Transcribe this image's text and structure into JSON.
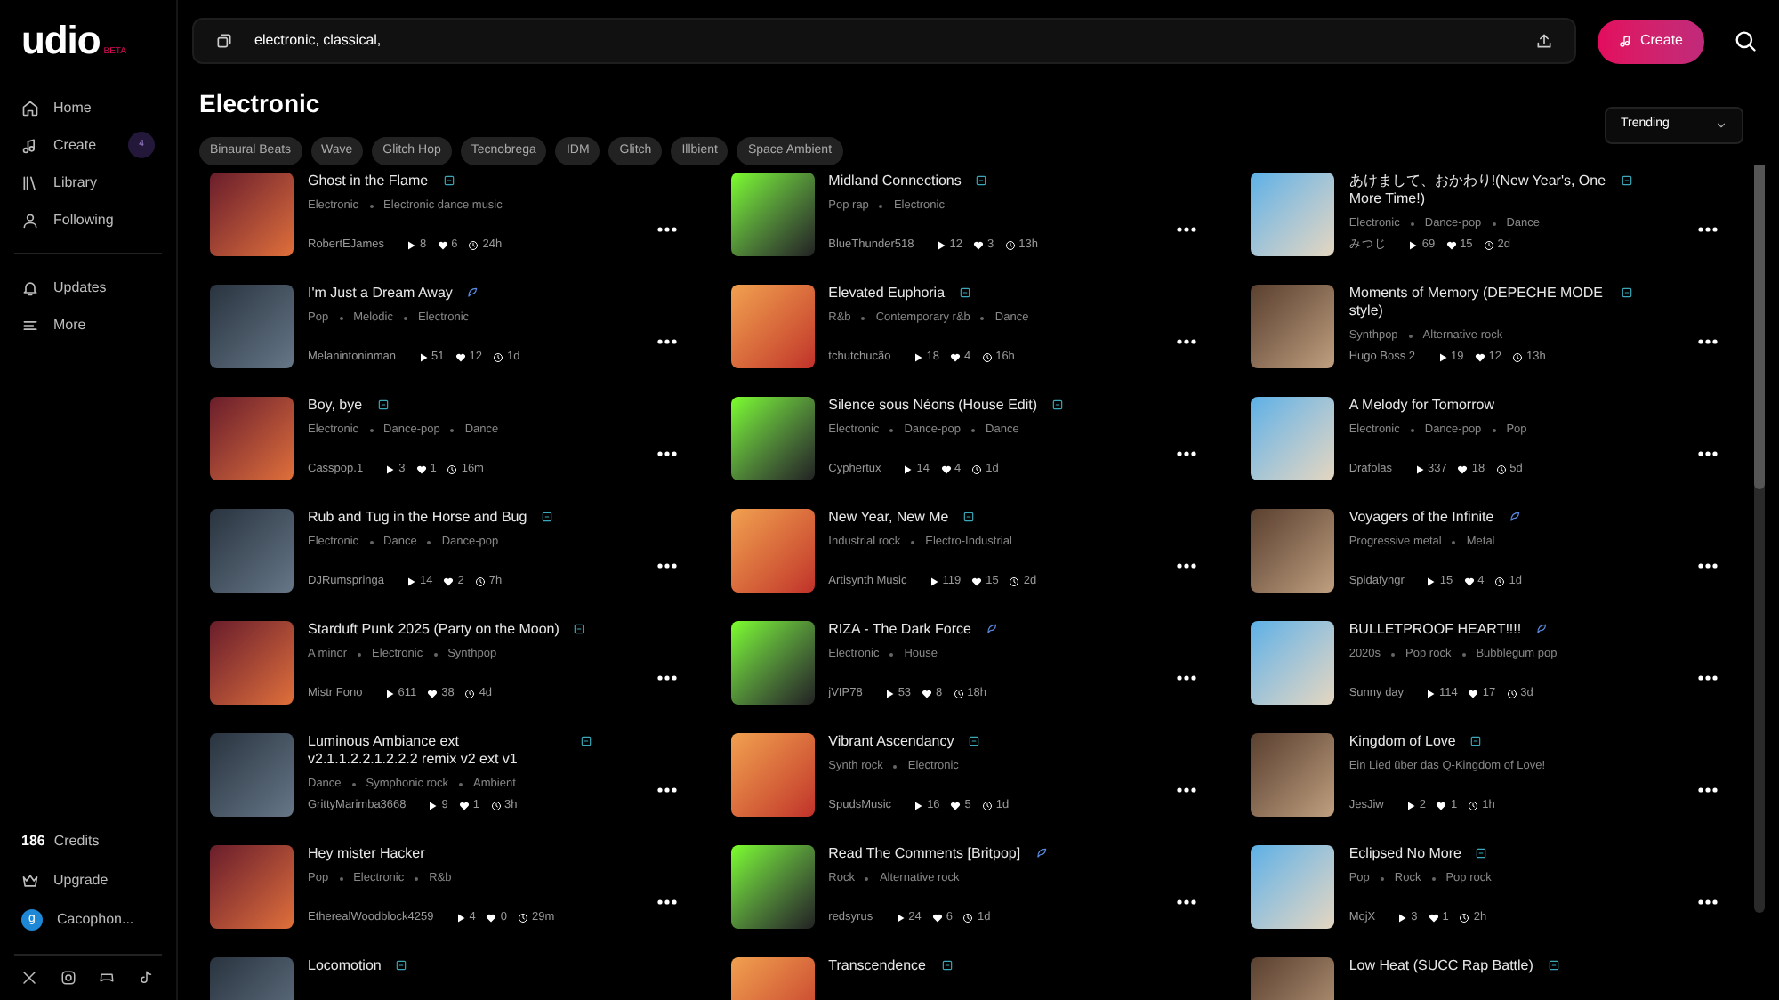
{
  "logo": {
    "text": "udio",
    "tag": "BETA"
  },
  "nav": [
    {
      "label": "Home"
    },
    {
      "label": "Create",
      "count": "4"
    },
    {
      "label": "Library"
    },
    {
      "label": "Following"
    }
  ],
  "nav_secondary": [
    {
      "label": "Updates"
    },
    {
      "label": "More"
    }
  ],
  "credits": {
    "count": "186",
    "label": "Credits"
  },
  "upgrade": "Upgrade",
  "user": {
    "initial": "g",
    "name": "Cacophon..."
  },
  "search": {
    "value": "electronic, classical,"
  },
  "create_button": "Create",
  "heading": "Electronic",
  "chips": [
    "Binaural Beats",
    "Wave",
    "Glitch Hop",
    "Tecnobrega",
    "IDM",
    "Glitch",
    "Illbient",
    "Space Ambient"
  ],
  "sort": {
    "value": "Trending"
  },
  "tracks": [
    {
      "title": "Ghost in the Flame",
      "kind": "box",
      "tags": [
        "Electronic",
        "Electronic dance music"
      ],
      "author": "RobertEJames",
      "plays": "8",
      "likes": "6",
      "age": "24h"
    },
    {
      "title": "Midland Connections",
      "kind": "box",
      "tags": [
        "Pop rap",
        "Electronic"
      ],
      "author": "BlueThunder518",
      "plays": "12",
      "likes": "3",
      "age": "13h"
    },
    {
      "title": "あけまして、おかわり!(New Year's, One More Time!)",
      "kind": "box",
      "tags": [
        "Electronic",
        "Dance-pop",
        "Dance"
      ],
      "author": "みつじ",
      "plays": "69",
      "likes": "15",
      "age": "2d"
    },
    {
      "title": "I'm Just a Dream Away",
      "kind": "feather",
      "tags": [
        "Pop",
        "Melodic",
        "Electronic"
      ],
      "author": "Melanintoninman",
      "plays": "51",
      "likes": "12",
      "age": "1d"
    },
    {
      "title": "Elevated Euphoria",
      "kind": "box",
      "tags": [
        "R&b",
        "Contemporary r&b",
        "Dance"
      ],
      "author": "tchutchucão",
      "plays": "18",
      "likes": "4",
      "age": "16h"
    },
    {
      "title": "Moments of Memory (DEPECHE MODE style)",
      "kind": "box",
      "tags": [
        "Synthpop",
        "Alternative rock"
      ],
      "author": "Hugo Boss 2",
      "plays": "19",
      "likes": "12",
      "age": "13h"
    },
    {
      "title": "Boy, bye",
      "kind": "box",
      "tags": [
        "Electronic",
        "Dance-pop",
        "Dance"
      ],
      "author": "Casspop.1",
      "plays": "3",
      "likes": "1",
      "age": "16m"
    },
    {
      "title": "Silence sous Néons (House Edit)",
      "kind": "box",
      "tags": [
        "Electronic",
        "Dance-pop",
        "Dance"
      ],
      "author": "Cyphertux",
      "plays": "14",
      "likes": "4",
      "age": "1d"
    },
    {
      "title": "A Melody for Tomorrow",
      "kind": "plain",
      "tags": [
        "Electronic",
        "Dance-pop",
        "Pop"
      ],
      "author": "Drafolas",
      "plays": "337",
      "likes": "18",
      "age": "5d"
    },
    {
      "title": "Rub and Tug in the Horse and Bug",
      "kind": "box",
      "tags": [
        "Electronic",
        "Dance",
        "Dance-pop"
      ],
      "author": "DJRumspringa",
      "plays": "14",
      "likes": "2",
      "age": "7h"
    },
    {
      "title": "New Year, New Me",
      "kind": "box",
      "tags": [
        "Industrial rock",
        "Electro-Industrial"
      ],
      "author": "Artisynth Music",
      "plays": "119",
      "likes": "15",
      "age": "2d"
    },
    {
      "title": "Voyagers of the Infinite",
      "kind": "feather",
      "tags": [
        "Progressive metal",
        "Metal"
      ],
      "author": "Spidafyngr",
      "plays": "15",
      "likes": "4",
      "age": "1d"
    },
    {
      "title": "Starduft Punk 2025 (Party on the Moon)",
      "kind": "box",
      "tags": [
        "A minor",
        "Electronic",
        "Synthpop"
      ],
      "author": "Mistr Fono",
      "plays": "611",
      "likes": "38",
      "age": "4d"
    },
    {
      "title": "RIZA - The Dark Force",
      "kind": "feather",
      "tags": [
        "Electronic",
        "House"
      ],
      "author": "jVIP78",
      "plays": "53",
      "likes": "8",
      "age": "18h"
    },
    {
      "title": "BULLETPROOF HEART!!!!",
      "kind": "feather",
      "tags": [
        "2020s",
        "Pop rock",
        "Bubblegum pop"
      ],
      "author": "Sunny day",
      "plays": "114",
      "likes": "17",
      "age": "3d"
    },
    {
      "title": "Luminous Ambiance ext v2.1.1.2.2.1.2.2.2 remix v2 ext v1",
      "kind": "box",
      "tags": [
        "Dance",
        "Symphonic rock",
        "Ambient"
      ],
      "author": "GrittyMarimba3668",
      "plays": "9",
      "likes": "1",
      "age": "3h"
    },
    {
      "title": "Vibrant Ascendancy",
      "kind": "box",
      "tags": [
        "Synth rock",
        "Electronic"
      ],
      "author": "SpudsMusic",
      "plays": "16",
      "likes": "5",
      "age": "1d"
    },
    {
      "title": "Kingdom of Love",
      "kind": "box",
      "description": "Ein Lied über das Q-Kingdom of Love!",
      "author": "JesJiw",
      "plays": "2",
      "likes": "1",
      "age": "1h"
    },
    {
      "title": "Hey mister Hacker",
      "kind": "plain",
      "tags": [
        "Pop",
        "Electronic",
        "R&b"
      ],
      "author": "EtherealWoodblock4259",
      "plays": "4",
      "likes": "0",
      "age": "29m"
    },
    {
      "title": "Read The Comments [Britpop]",
      "kind": "feather",
      "tags": [
        "Rock",
        "Alternative rock"
      ],
      "author": "redsyrus",
      "plays": "24",
      "likes": "6",
      "age": "1d"
    },
    {
      "title": "Eclipsed No More",
      "kind": "box",
      "tags": [
        "Pop",
        "Rock",
        "Pop rock"
      ],
      "author": "MojX",
      "plays": "3",
      "likes": "1",
      "age": "2h"
    },
    {
      "title": "Locomotion",
      "kind": "box"
    },
    {
      "title": "Transcendence",
      "kind": "box"
    },
    {
      "title": "Low Heat (SUCC Rap Battle)",
      "kind": "box"
    }
  ]
}
